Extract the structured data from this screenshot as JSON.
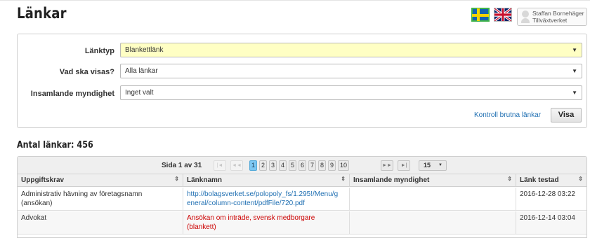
{
  "header": {
    "title": "Länkar",
    "language_icons": [
      "swedish-flag-icon",
      "british-flag-icon"
    ],
    "user": {
      "name": "Staffan Bornehäger",
      "organization": "Tillväxtverket"
    }
  },
  "filters": {
    "link_type": {
      "label": "Länktyp",
      "value": "Blankettlänk"
    },
    "display": {
      "label": "Vad ska visas?",
      "value": "Alla länkar"
    },
    "authority": {
      "label": "Insamlande myndighet",
      "value": "Inget valt"
    },
    "check_broken_link": "Kontroll brutna länkar",
    "show_button": "Visa"
  },
  "results": {
    "count_title": "Antal länkar: 456",
    "pager": {
      "page_info": "Sida 1 av 31",
      "first": "|◄",
      "prev": "◄◄",
      "pages": [
        "1",
        "2",
        "3",
        "4",
        "5",
        "6",
        "7",
        "8",
        "9",
        "10"
      ],
      "current_page": "1",
      "next": "►►",
      "last": "►|",
      "page_size": "15"
    },
    "columns": [
      "Uppgiftskrav",
      "Länknamn",
      "Insamlande myndighet",
      "Länk testad"
    ],
    "rows": [
      {
        "requirement_line1": "Administrativ hävning av företagsnamn",
        "requirement_line2": "(ansökan)",
        "link_line1": "http://bolagsverket.se/polopoly_fs/1.295!/Menu/g",
        "link_line2": "eneral/column-content/pdfFile/720.pdf",
        "authority": "",
        "tested": "2016-12-28 03:22"
      },
      {
        "requirement_line1": "Advokat",
        "requirement_line2": "",
        "link_line1": "Ansökan om inträde, svensk medborgare",
        "link_line2": "(blankett)",
        "authority": "",
        "tested": "2016-12-14 03:04"
      }
    ]
  },
  "colors": {
    "accent_link": "#1f6fb2",
    "broken_link": "#cc0000",
    "highlight_select": "#ffffc4",
    "current_page": "#7cc7f2"
  }
}
